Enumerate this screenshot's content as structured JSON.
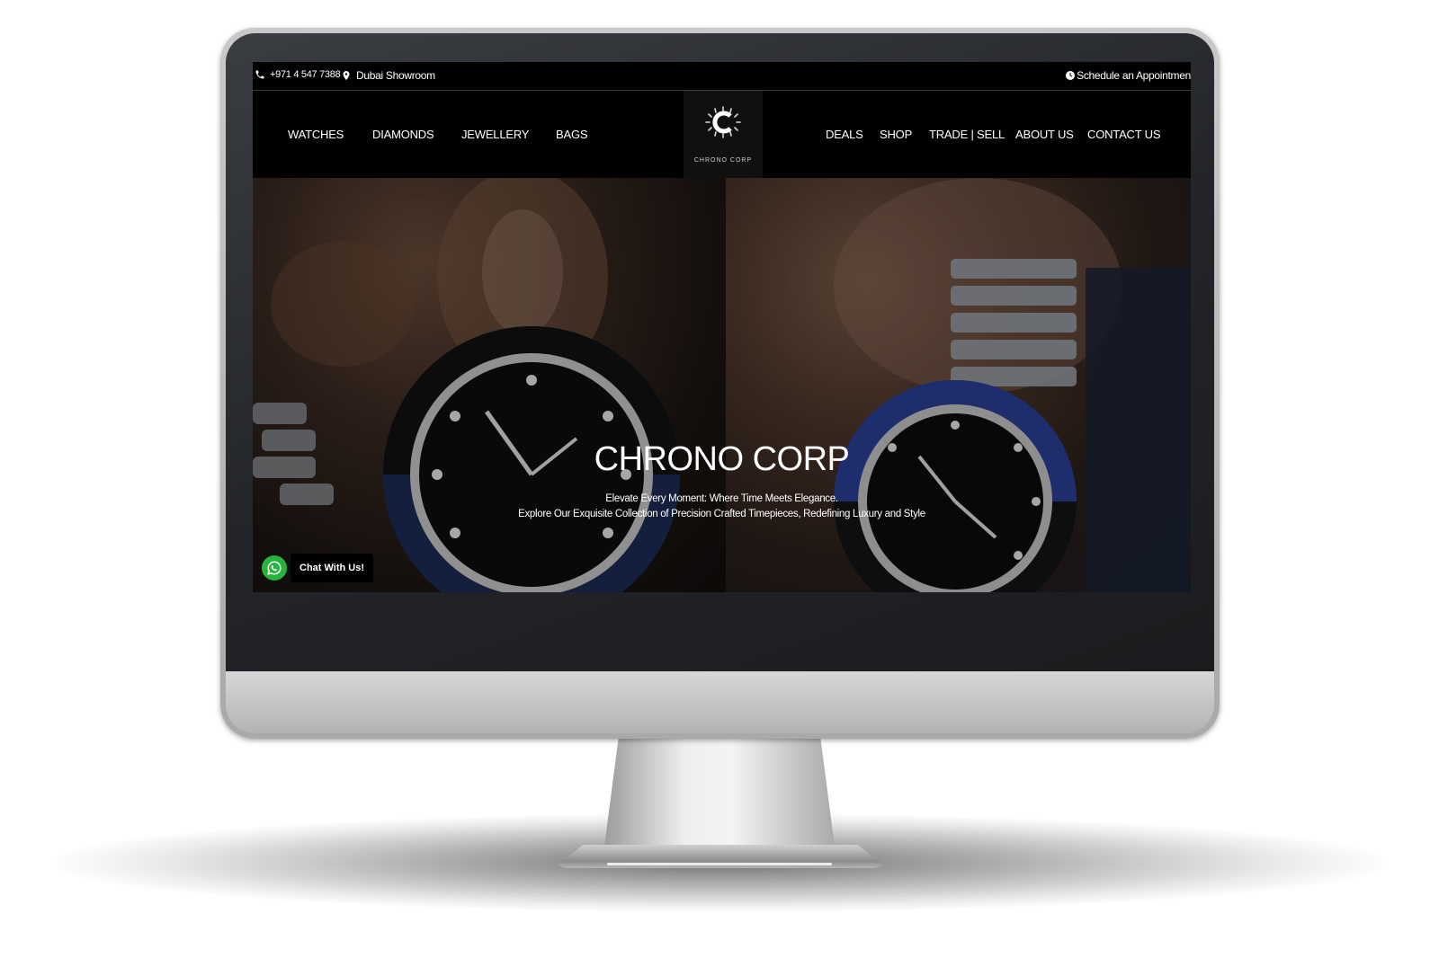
{
  "topbar": {
    "phone": "+971 4 547 7388",
    "location": "Dubai Showroom",
    "appointment": "Schedule an Appointmen"
  },
  "nav": {
    "left": [
      "WATCHES",
      "DIAMONDS",
      "JEWELLERY",
      "BAGS"
    ],
    "right": [
      "DEALS",
      "SHOP",
      "TRADE | SELL",
      "ABOUT US",
      "CONTACT US"
    ],
    "logo_text": "CHRONO CORP"
  },
  "hero": {
    "title": "CHRONO CORP",
    "subtitle_line1": "Elevate Every Moment: Where Time Meets Elegance.",
    "subtitle_line2": "Explore Our Exquisite Collection of Precision Crafted Timepieces, Redefining Luxury and Style"
  },
  "chat": {
    "label": "Chat With Us!"
  },
  "colors": {
    "header_bg": "#000000",
    "text": "#ffffff",
    "whatsapp": "#26b43c"
  },
  "icons": [
    "phone-icon",
    "location-pin-icon",
    "clock-icon",
    "whatsapp-icon",
    "logo-icon"
  ]
}
